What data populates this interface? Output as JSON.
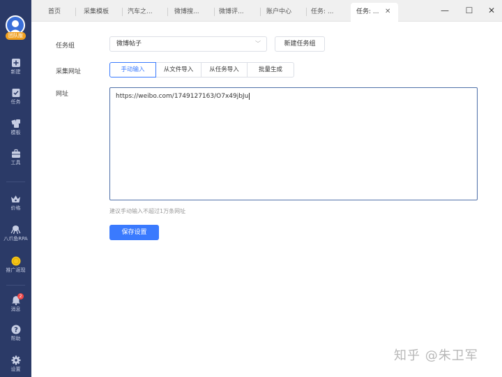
{
  "sidebar": {
    "avatar_badge": "团队版",
    "items": [
      {
        "label": "新建",
        "icon": "plus-square-icon"
      },
      {
        "label": "任务",
        "icon": "task-icon"
      },
      {
        "label": "模板",
        "icon": "template-icon"
      },
      {
        "label": "工具",
        "icon": "toolbox-icon"
      },
      {
        "label": "价格",
        "icon": "crown-icon"
      },
      {
        "label": "八爪鱼RPA",
        "icon": "octopus-icon"
      },
      {
        "label": "推广返现",
        "icon": "coin-icon"
      },
      {
        "label": "消息",
        "icon": "bell-icon",
        "badge": "2"
      },
      {
        "label": "帮助",
        "icon": "help-icon"
      },
      {
        "label": "设置",
        "icon": "gear-icon"
      }
    ]
  },
  "tabs": [
    {
      "label": "首页"
    },
    {
      "label": "采集模板"
    },
    {
      "label": "汽车之..."
    },
    {
      "label": "微博搜..."
    },
    {
      "label": "微博评..."
    },
    {
      "label": "账户中心"
    },
    {
      "label": "任务: ..."
    },
    {
      "label": "任务: ...",
      "active": true
    }
  ],
  "form": {
    "task_group_label": "任务组",
    "task_group_value": "微博帖子",
    "new_group_button": "新建任务组",
    "url_source_label": "采集网址",
    "url_source_options": [
      "手动输入",
      "从文件导入",
      "从任务导入",
      "批量生成"
    ],
    "url_source_selected": "手动输入",
    "url_label": "网址",
    "url_value": "https://weibo.com/1749127163/O7x49jbJu",
    "hint": "建议手动输入不超过1万条网址",
    "save_button": "保存设置"
  },
  "watermark": "知乎 @朱卫军",
  "colors": {
    "sidebar": "#2b3a67",
    "accent": "#3a7afe",
    "badge": "#f04848"
  }
}
